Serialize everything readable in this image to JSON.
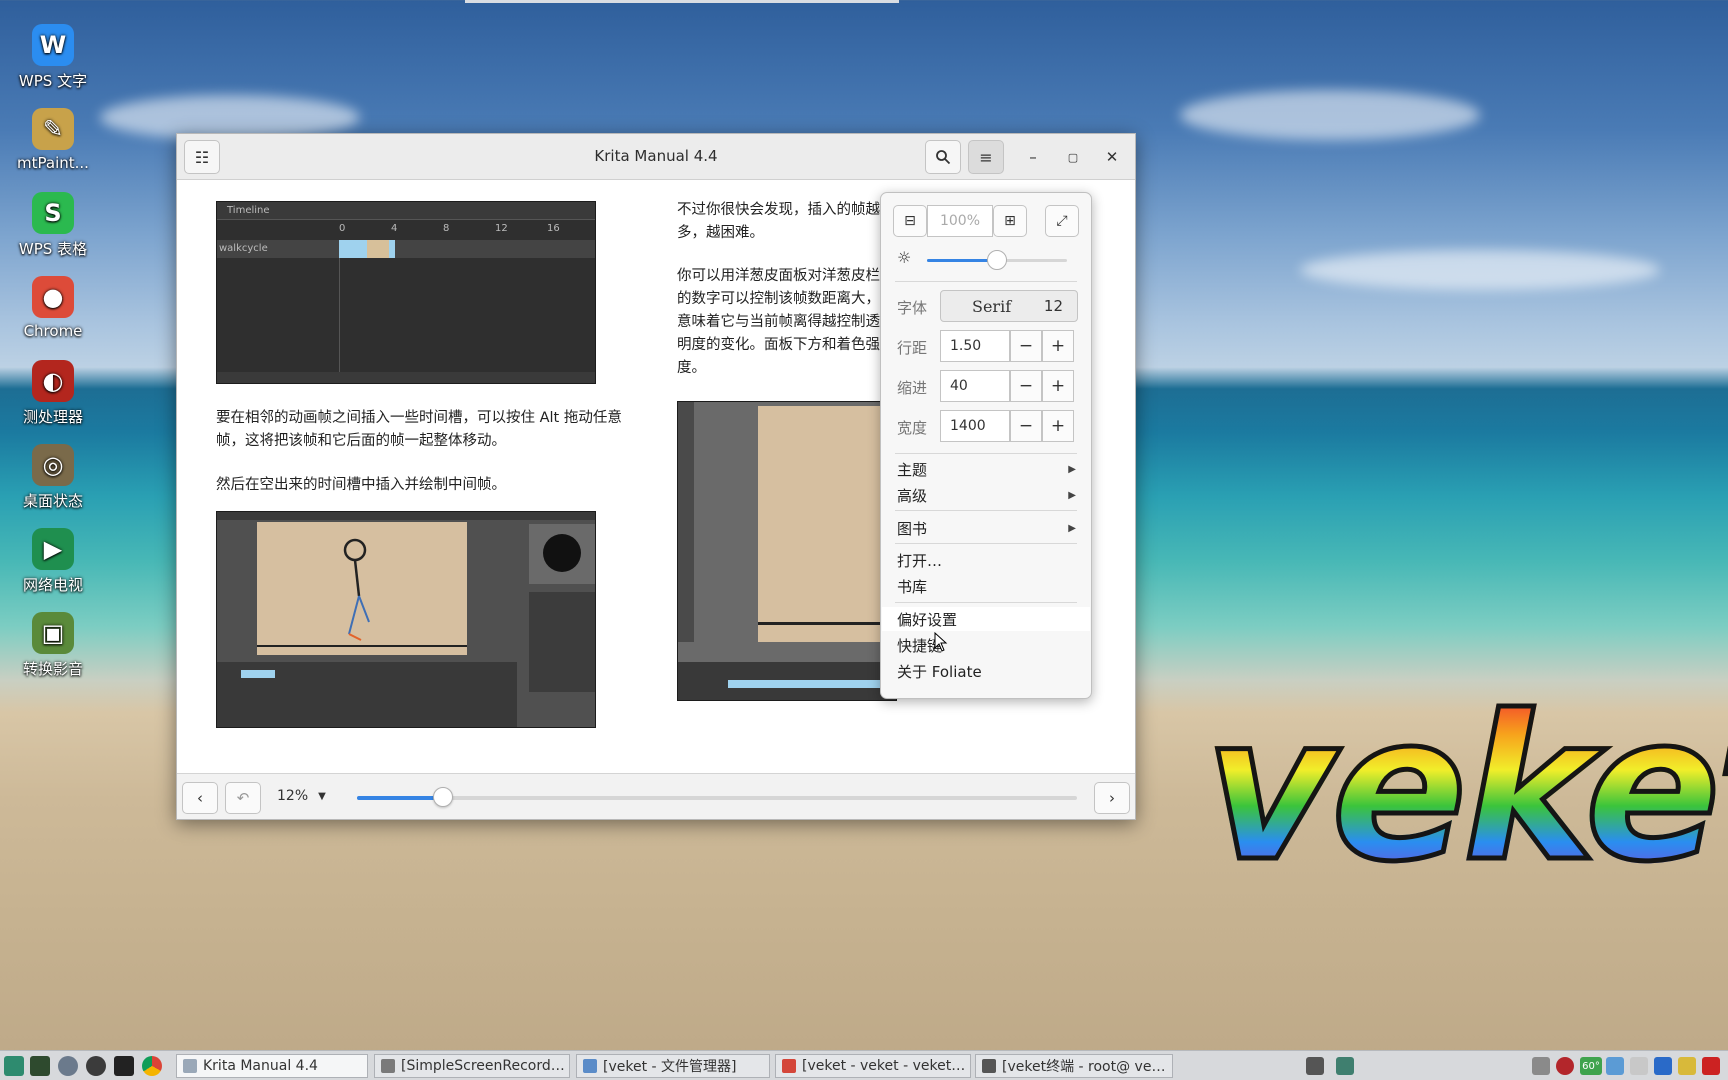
{
  "desktop": {
    "icons": [
      {
        "label": "WPS 文字",
        "icon": "wps-writer-icon",
        "glyph": "W",
        "color": "#2b8df0"
      },
      {
        "label": "mtPaint...",
        "icon": "mtpaint-icon",
        "glyph": "✎",
        "color": "#c8a24a"
      },
      {
        "label": "WPS 表格",
        "icon": "wps-spreadsheet-icon",
        "glyph": "S",
        "color": "#2bb94f"
      },
      {
        "label": "Chrome",
        "icon": "chrome-icon",
        "glyph": "●",
        "color": "#dd4b39"
      },
      {
        "label": "测处理器",
        "icon": "processor-test-icon",
        "glyph": "◐",
        "color": "#b3261e"
      },
      {
        "label": "桌面状态",
        "icon": "desktop-status-icon",
        "glyph": "◎",
        "color": "#7a6a4a"
      },
      {
        "label": "网络电视",
        "icon": "network-tv-icon",
        "glyph": "▶",
        "color": "#1f8f4f"
      },
      {
        "label": "转换影音",
        "icon": "media-convert-icon",
        "glyph": "▣",
        "color": "#5a8a3a"
      }
    ],
    "wallpaper_text": "veket"
  },
  "window": {
    "title": "Krita Manual 4.4",
    "content": {
      "left_para1": "要在相邻的动画帧之间插入一些时间槽，可以按住 Alt 拖动任意帧，这将把该帧和它后面的帧一起整体移动。",
      "left_para2": "然后在空出来的时间槽中插入并绘制中间帧。",
      "right_para1": "不过你很快会发现，插入的帧越多，越困难。",
      "right_para2": "你可以用洋葱皮面板对洋葱皮栏的数字可以控制该帧数距离大，意味着它与当前帧离得越控制透明度的变化。面板下方和着色强度。",
      "timeline_title": "Timeline",
      "timeline_layer": "walkcycle",
      "timeline_ticks": [
        "0",
        "4",
        "8",
        "12",
        "16"
      ]
    },
    "bottom": {
      "zoom_value": "12%",
      "progress": 0.12
    }
  },
  "popover": {
    "zoom_label": "100%",
    "brightness": 0.5,
    "font_label": "字体",
    "font_name": "Serif",
    "font_size": "12",
    "spacing_label": "行距",
    "spacing_value": "1.50",
    "indent_label": "缩进",
    "indent_value": "40",
    "width_label": "宽度",
    "width_value": "1400",
    "menu": {
      "theme": "主题",
      "advanced": "高级",
      "book": "图书",
      "open": "打开…",
      "library": "书库",
      "preferences": "偏好设置",
      "shortcuts": "快捷键",
      "about": "关于 Foliate"
    }
  },
  "taskbar": {
    "tasks": [
      {
        "label": "Krita Manual 4.4",
        "icon_color": "#9aa8b8"
      },
      {
        "label": "[SimpleScreenRecord…",
        "icon_color": "#7a7a7a"
      },
      {
        "label": "[veket - 文件管理器]",
        "icon_color": "#5b8cc8"
      },
      {
        "label": "[veket - veket - veket…",
        "icon_color": "#d4463a"
      },
      {
        "label": "[veket终端 - root@ ve…",
        "icon_color": "#555555"
      }
    ],
    "tray_temp": "60°"
  }
}
